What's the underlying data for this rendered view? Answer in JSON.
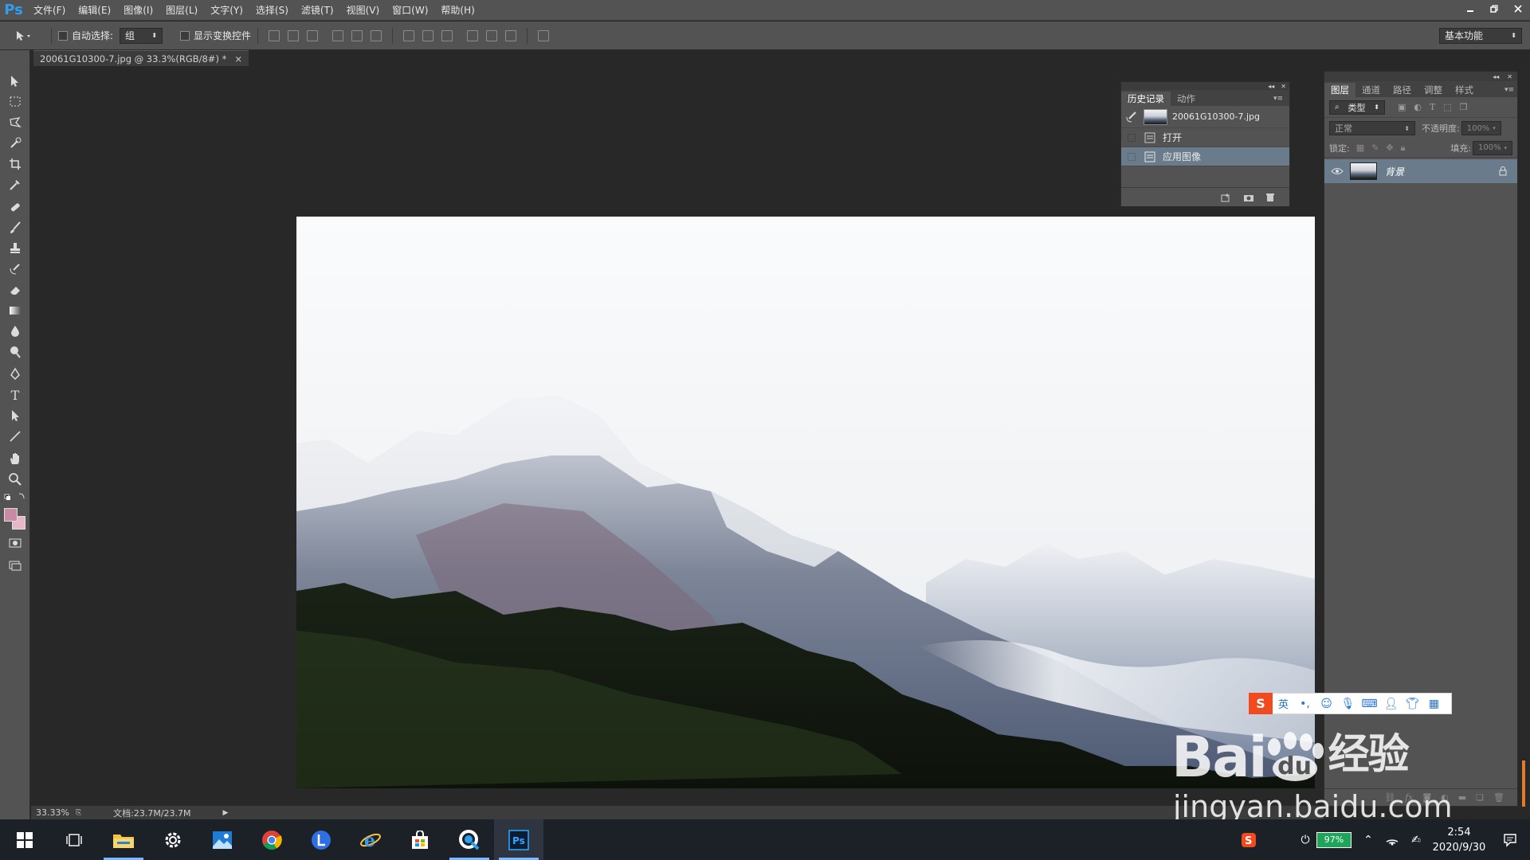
{
  "app": {
    "logo": "Ps"
  },
  "menu": [
    "文件(F)",
    "编辑(E)",
    "图像(I)",
    "图层(L)",
    "文字(Y)",
    "选择(S)",
    "滤镜(T)",
    "视图(V)",
    "窗口(W)",
    "帮助(H)"
  ],
  "options": {
    "auto_select_label": "自动选择:",
    "auto_select_value": "组",
    "show_transform_label": "显示变换控件",
    "workspace": "基本功能"
  },
  "document": {
    "tab_title": "20061G10300-7.jpg @ 33.3%(RGB/8#) *",
    "zoom": "33.33%",
    "doc_info": "文档:23.7M/23.7M"
  },
  "history_panel": {
    "tabs": [
      "历史记录",
      "动作"
    ],
    "snapshot": "20061G10300-7.jpg",
    "steps": [
      "打开",
      "应用图像"
    ]
  },
  "layers_panel": {
    "tabs": [
      "图层",
      "通道",
      "路径",
      "调整",
      "样式"
    ],
    "filter_label": "类型",
    "blend_mode": "正常",
    "opacity_label": "不透明度:",
    "opacity_value": "100%",
    "lock_label": "锁定:",
    "fill_label": "填充:",
    "fill_value": "100%",
    "layers": [
      {
        "name": "背景"
      }
    ]
  },
  "taskbar": {
    "battery": "97%",
    "time": "2:54",
    "date": "2020/9/30"
  },
  "ime": {
    "mode": "英"
  },
  "watermark": {
    "brand": "Bai",
    "brand_du": "du",
    "product": "经验",
    "url": "jingyan.baidu.com"
  }
}
